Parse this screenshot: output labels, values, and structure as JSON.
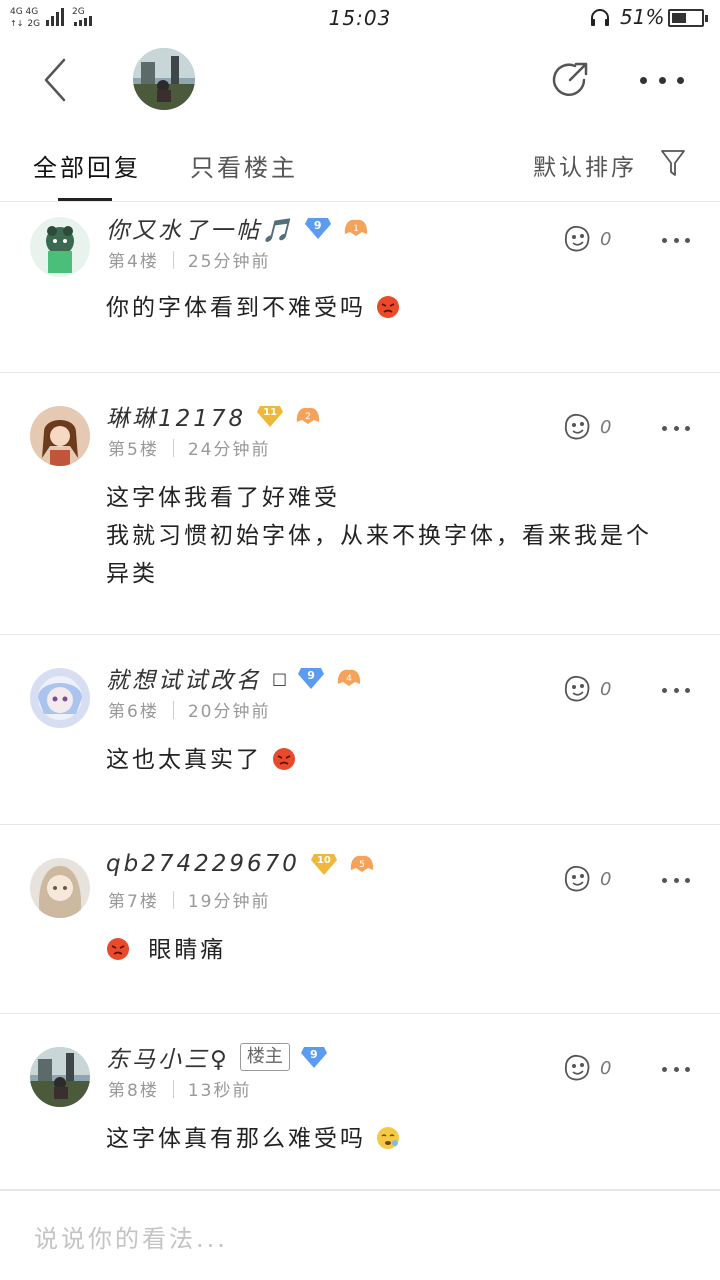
{
  "status_bar": {
    "network_1": "4G 4G",
    "network_1b": "2G",
    "network_2": "2G",
    "time": "15:03",
    "battery_percent": "51%",
    "battery_level": 0.51
  },
  "header": {
    "back_icon": "chevron-left-icon",
    "share_icon": "share-icon",
    "more_icon": "more-horizontal-icon"
  },
  "tabs": {
    "all_replies": "全部回复",
    "owner_only": "只看楼主",
    "sort": "默认排序",
    "filter_icon": "filter-icon"
  },
  "posts": [
    {
      "username": "你又水了一帖🎵",
      "level": "9",
      "badge_level": "1",
      "floor": "第4楼",
      "time": "25分钟前",
      "likes": "0",
      "content": "你的字体看到不难受吗",
      "is_owner": false
    },
    {
      "username": "琳琳12178",
      "level": "11",
      "badge_level": "2",
      "floor": "第5楼",
      "time": "24分钟前",
      "likes": "0",
      "content_lines": [
        "这字体我看了好难受",
        "我就习惯初始字体，从来不换字体，看来我是个",
        "异类"
      ],
      "is_owner": false
    },
    {
      "username": "就想试试改名",
      "level": "9",
      "badge_level": "4",
      "floor": "第6楼",
      "time": "20分钟前",
      "likes": "0",
      "content": "这也太真实了",
      "is_owner": false
    },
    {
      "username": "qb274229670",
      "level": "10",
      "badge_level": "5",
      "floor": "第7楼",
      "time": "19分钟前",
      "likes": "0",
      "content": "眼睛痛",
      "is_owner": false
    },
    {
      "username": "东马小三♀",
      "owner_tag": "楼主",
      "level": "9",
      "floor": "第8楼",
      "time": "13秒前",
      "likes": "0",
      "content": "这字体真有那么难受吗",
      "is_owner": true
    }
  ],
  "reply_bar": {
    "placeholder": "说说你的看法..."
  },
  "colors": {
    "level_blue": "#5b9cf0",
    "level_gold": "#f0b83a",
    "badge_orange": "#f5a25a",
    "emoji_red": "#e84a2a",
    "divider": "#e6e6e6"
  }
}
